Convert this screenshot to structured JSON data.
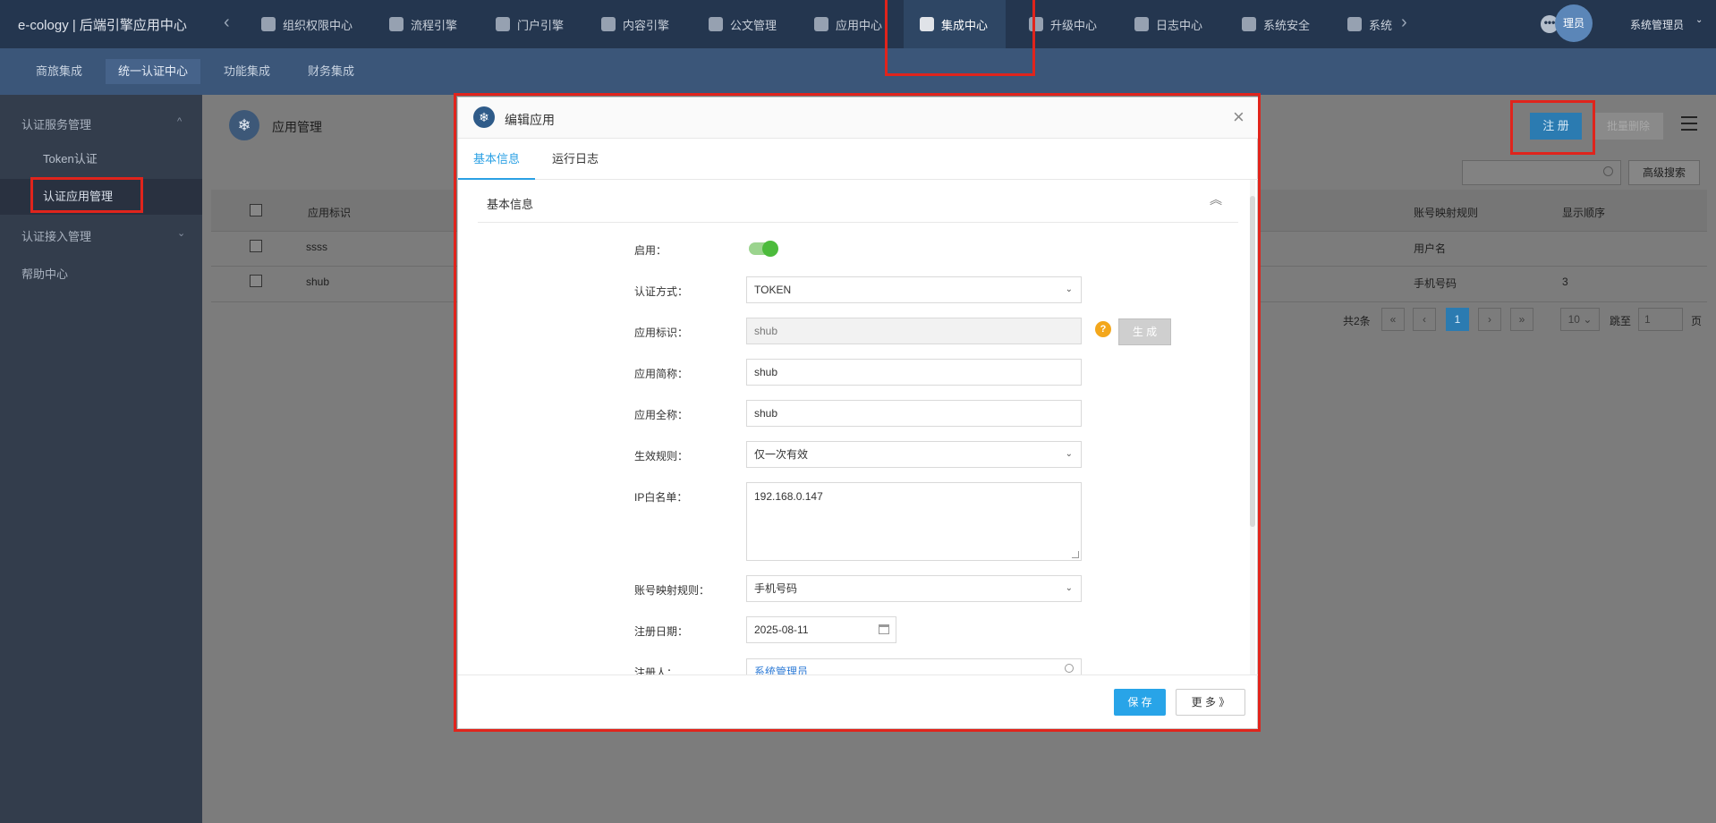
{
  "app_title": "e-cology | 后端引擎应用中心",
  "nav_left_arrow": "‹",
  "nav_right_arrow": "›",
  "top_nav": [
    {
      "label": "组织权限中心",
      "icon": "shield-icon"
    },
    {
      "label": "流程引擎",
      "icon": "flow-icon"
    },
    {
      "label": "门户引擎",
      "icon": "portal-icon"
    },
    {
      "label": "内容引擎",
      "icon": "content-icon"
    },
    {
      "label": "公文管理",
      "icon": "document-icon"
    },
    {
      "label": "应用中心",
      "icon": "apps-icon"
    },
    {
      "label": "集成中心",
      "icon": "integration-icon"
    },
    {
      "label": "升级中心",
      "icon": "upgrade-icon"
    },
    {
      "label": "日志中心",
      "icon": "log-icon"
    },
    {
      "label": "系统安全",
      "icon": "security-icon"
    },
    {
      "label": "系统",
      "icon": "system-icon"
    }
  ],
  "more_dots": "•••",
  "avatar_text": "理员",
  "user_name": "系统管理员",
  "user_caret": "⌄",
  "sub_nav": [
    "商旅集成",
    "统一认证中心",
    "功能集成",
    "财务集成"
  ],
  "sidebar": {
    "group1": "认证服务管理",
    "group1_caret": "^",
    "item1": "Token认证",
    "item2": "认证应用管理",
    "group2": "认证接入管理",
    "group2_caret": "⌄",
    "group3": "帮助中心"
  },
  "page": {
    "icon_glyph": "❄",
    "title": "应用管理",
    "register_btn": "注 册",
    "batch_delete_btn": "批量删除",
    "adv_search_btn": "高级搜索",
    "table_headers": {
      "col_id": "应用标识",
      "col_mapping": "账号映射规则",
      "col_order": "显示顺序"
    },
    "rows": [
      {
        "id": "ssss",
        "mapping": "用户名",
        "order": ""
      },
      {
        "id": "shub",
        "mapping": "手机号码",
        "order": "3"
      }
    ],
    "pager": {
      "total": "共2条",
      "first": "«",
      "prev": "‹",
      "current": "1",
      "next": "›",
      "last": "»",
      "page_size": "10",
      "page_size_caret": "⌄",
      "jump_label": "跳至",
      "jump_value": "1",
      "page_suffix": "页"
    }
  },
  "modal": {
    "logo_glyph": "❄",
    "title": "编辑应用",
    "close": "×",
    "tabs": [
      "基本信息",
      "运行日志"
    ],
    "section_title": "基本信息",
    "collapse_glyph": "︽",
    "select_caret": "⌄",
    "fields": {
      "enable_label": "启用：",
      "auth_method_label": "认证方式：",
      "auth_method_value": "TOKEN",
      "app_id_label": "应用标识：",
      "app_id_value": "shub",
      "help_glyph": "?",
      "generate_btn": "生 成",
      "short_name_label": "应用简称：",
      "short_name_value": "shub",
      "full_name_label": "应用全称：",
      "full_name_value": "shub",
      "rule_label": "生效规则：",
      "rule_value": "仅一次有效",
      "ip_label": "IP白名单：",
      "ip_value": "192.168.0.147",
      "mapping_label": "账号映射规则：",
      "mapping_value": "手机号码",
      "date_label": "注册日期：",
      "date_value": "2025-08-11",
      "registrant_label": "注册人：",
      "registrant_value": "系统管理员"
    },
    "save_btn": "保 存",
    "more_btn": "更 多 》"
  },
  "colors": {
    "topbar": "#24364f",
    "subnav": "#3b5679",
    "sidebar": "#333d4c",
    "accent": "#28a4e8",
    "toggle_on": "#4cbb3c",
    "highlight": "#e0241c"
  }
}
